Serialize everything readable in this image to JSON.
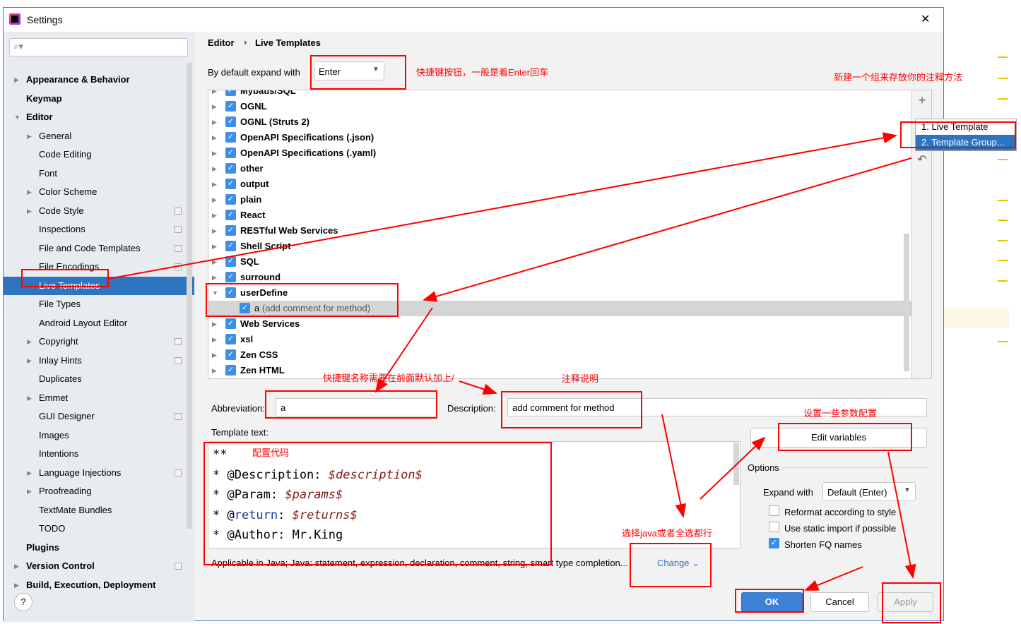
{
  "window": {
    "title": "Settings",
    "close": "✕"
  },
  "search": {
    "placeholder": ""
  },
  "breadcrumb": {
    "parent": "Editor",
    "sep": "›",
    "current": "Live Templates"
  },
  "expand": {
    "label": "By default expand with",
    "value": "Enter"
  },
  "sidebar": {
    "items": [
      {
        "label": "Appearance & Behavior",
        "level": 0,
        "bold": true,
        "arrow": "right"
      },
      {
        "label": "Keymap",
        "level": 0,
        "bold": true
      },
      {
        "label": "Editor",
        "level": 0,
        "bold": true,
        "arrow": "down"
      },
      {
        "label": "General",
        "level": 1,
        "arrow": "right"
      },
      {
        "label": "Code Editing",
        "level": 1
      },
      {
        "label": "Font",
        "level": 1
      },
      {
        "label": "Color Scheme",
        "level": 1,
        "arrow": "right"
      },
      {
        "label": "Code Style",
        "level": 1,
        "arrow": "right",
        "copy": true
      },
      {
        "label": "Inspections",
        "level": 1,
        "copy": true
      },
      {
        "label": "File and Code Templates",
        "level": 1,
        "copy": true
      },
      {
        "label": "File Encodings",
        "level": 1,
        "copy": true
      },
      {
        "label": "Live Templates",
        "level": 1,
        "selected": true
      },
      {
        "label": "File Types",
        "level": 1
      },
      {
        "label": "Android Layout Editor",
        "level": 1
      },
      {
        "label": "Copyright",
        "level": 1,
        "arrow": "right",
        "copy": true
      },
      {
        "label": "Inlay Hints",
        "level": 1,
        "arrow": "right",
        "copy": true
      },
      {
        "label": "Duplicates",
        "level": 1
      },
      {
        "label": "Emmet",
        "level": 1,
        "arrow": "right"
      },
      {
        "label": "GUI Designer",
        "level": 1,
        "copy": true
      },
      {
        "label": "Images",
        "level": 1
      },
      {
        "label": "Intentions",
        "level": 1
      },
      {
        "label": "Language Injections",
        "level": 1,
        "arrow": "right",
        "copy": true
      },
      {
        "label": "Proofreading",
        "level": 1,
        "arrow": "right"
      },
      {
        "label": "TextMate Bundles",
        "level": 1
      },
      {
        "label": "TODO",
        "level": 1
      },
      {
        "label": "Plugins",
        "level": 0,
        "bold": true
      },
      {
        "label": "Version Control",
        "level": 0,
        "bold": true,
        "arrow": "right",
        "copy": true
      },
      {
        "label": "Build, Execution, Deployment",
        "level": 0,
        "bold": true,
        "arrow": "right"
      }
    ]
  },
  "tree": {
    "groups": [
      {
        "label": "Mybatis/SQL",
        "checked": true
      },
      {
        "label": "OGNL",
        "checked": true
      },
      {
        "label": "OGNL (Struts 2)",
        "checked": true
      },
      {
        "label": "OpenAPI Specifications (.json)",
        "checked": true
      },
      {
        "label": "OpenAPI Specifications (.yaml)",
        "checked": true
      },
      {
        "label": "other",
        "checked": true
      },
      {
        "label": "output",
        "checked": true
      },
      {
        "label": "plain",
        "checked": true
      },
      {
        "label": "React",
        "checked": true
      },
      {
        "label": "RESTful Web Services",
        "checked": true
      },
      {
        "label": "Shell Script",
        "checked": true
      },
      {
        "label": "SQL",
        "checked": true
      },
      {
        "label": "surround",
        "checked": true
      },
      {
        "label": "userDefine",
        "checked": true,
        "expanded": true
      },
      {
        "label": "a",
        "desc": "(add comment for method)",
        "checked": true,
        "child": true
      },
      {
        "label": "Web Services",
        "checked": true
      },
      {
        "label": "xsl",
        "checked": true
      },
      {
        "label": "Zen CSS",
        "checked": true
      },
      {
        "label": "Zen HTML",
        "checked": true
      }
    ]
  },
  "add_menu": {
    "items": [
      "1. Live Template",
      "2. Template Group..."
    ]
  },
  "form": {
    "abbreviation_label": "Abbreviation:",
    "abbreviation": "a",
    "description_label": "Description:",
    "description": "add comment for method",
    "template_text_label": "Template text:",
    "code": {
      "l1": "**",
      "l2a": "* @Description: ",
      "l2b": "$description$",
      "l3a": "* @Param: ",
      "l3b": "$params$",
      "l4a": "* @",
      "l4k": "return",
      "l4c": ": ",
      "l4b": "$returns$",
      "l5": "* @Author: Mr.King"
    },
    "applicable": "Applicable in Java; Java: statement, expression, declaration, comment, string, smart type completion...",
    "change": "Change"
  },
  "options": {
    "edit_variables": "Edit variables",
    "title": "Options",
    "expand_label": "Expand with",
    "expand_value": "Default (Enter)",
    "reformat": "Reformat according to style",
    "reformat_checked": false,
    "static_import": "Use static import if possible",
    "static_import_checked": false,
    "shorten": "Shorten FQ names",
    "shorten_checked": true
  },
  "buttons": {
    "ok": "OK",
    "cancel": "Cancel",
    "apply": "Apply",
    "help": "?"
  },
  "annotations": {
    "expand_note": "快捷键按钮，一般是着Enter回车",
    "group_note": "新建一个组来存放你的注释方法",
    "abbr_note": "快捷键名称需要在前面默认加上/",
    "desc_note": "注释说明",
    "code_note": "配置代码",
    "params_note": "设置一些参数配置",
    "context_note": "选择java或者全选都行"
  },
  "colors": {
    "accent": "#2e74c0",
    "checkbox": "#3d8ee6",
    "annotation": "#ff0000"
  }
}
